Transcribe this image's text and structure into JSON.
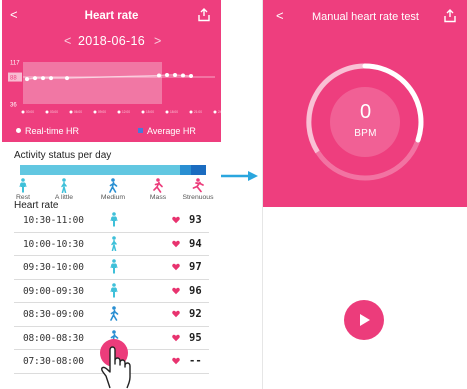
{
  "left": {
    "header": {
      "title": "Heart rate",
      "back_icon": "chevron-left-icon",
      "share_icon": "share-icon"
    },
    "date_nav": {
      "prev": "<",
      "date": "2018-06-16",
      "next": ">"
    },
    "chart_data": {
      "type": "line",
      "y_ticks": [
        "117",
        "88",
        "36"
      ],
      "highlight_tick": "88",
      "x_ticks": [
        "00:00",
        "03:00",
        "06:00",
        "09:00",
        "12:00",
        "15:00",
        "18:00",
        "21:00",
        "24:00"
      ],
      "series": [
        {
          "name": "Real-time HR",
          "x": [
            "00:30",
            "01:30",
            "02:30",
            "03:30",
            "05:30",
            "17:00",
            "18:00",
            "19:00",
            "20:00",
            "21:00"
          ],
          "values": [
            84,
            86,
            86,
            86,
            86,
            91,
            92,
            92,
            91,
            90
          ]
        }
      ],
      "ylim": [
        36,
        117
      ],
      "colors": {
        "line": "#ffffff",
        "plot_band": "#f28bb1",
        "background": "#ee3e7e"
      }
    },
    "legend": {
      "realtime": "Real-time HR",
      "average": "Average HR",
      "average_color": "#4a79d8"
    },
    "activity": {
      "title": "Activity status per day",
      "levels": [
        {
          "label": "Rest",
          "icon": "standing-person-icon",
          "color": "#3fc0d9"
        },
        {
          "label": "A little",
          "icon": "walking-person-icon",
          "color": "#3fc0d9"
        },
        {
          "label": "Medium",
          "icon": "walking-fast-person-icon",
          "color": "#2a8fd2"
        },
        {
          "label": "Mass",
          "icon": "running-person-icon",
          "color": "#ec3c7b"
        },
        {
          "label": "Strenuous",
          "icon": "sprinting-person-icon",
          "color": "#ec3c7b"
        }
      ],
      "bar_shares": [
        0.86,
        0.06,
        0.08
      ]
    },
    "heart_rate": {
      "title": "Heart rate",
      "rows": [
        {
          "time": "10:30-11:00",
          "icon": "standing-person-icon",
          "value": "93"
        },
        {
          "time": "10:00-10:30",
          "icon": "walking-person-icon",
          "value": "94"
        },
        {
          "time": "09:30-10:00",
          "icon": "standing-person-icon",
          "value": "97"
        },
        {
          "time": "09:00-09:30",
          "icon": "standing-person-icon",
          "value": "96"
        },
        {
          "time": "08:30-09:00",
          "icon": "walking-fast-person-icon",
          "value": "92"
        },
        {
          "time": "08:00-08:30",
          "icon": "walking-fast-person-icon",
          "value": "95"
        },
        {
          "time": "07:30-08:00",
          "icon": "heart-button-icon",
          "value": "--"
        }
      ]
    }
  },
  "right": {
    "header": {
      "title": "Manual heart rate test",
      "back_icon": "chevron-left-icon",
      "share_icon": "share-icon"
    },
    "gauge": {
      "value": "0",
      "unit": "BPM"
    },
    "start_button_icon": "play-icon"
  },
  "colors": {
    "accent": "#ee3e7e",
    "button": "#ec3c7b",
    "arrow": "#2aa6de",
    "heart": "#e8336f"
  }
}
